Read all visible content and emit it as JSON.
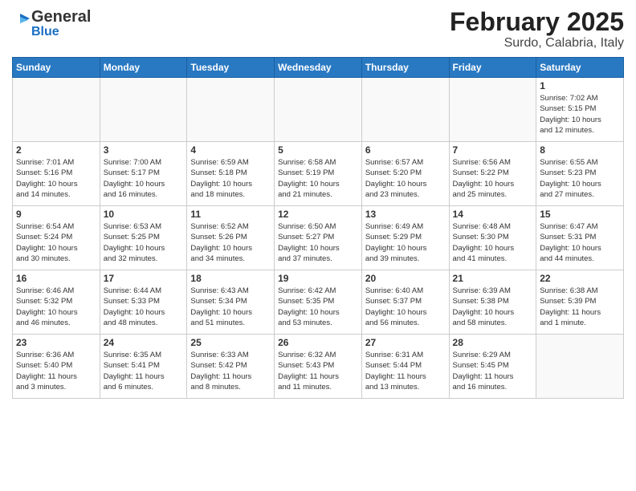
{
  "header": {
    "logo_general": "General",
    "logo_blue": "Blue",
    "title": "February 2025",
    "subtitle": "Surdo, Calabria, Italy"
  },
  "weekdays": [
    "Sunday",
    "Monday",
    "Tuesday",
    "Wednesday",
    "Thursday",
    "Friday",
    "Saturday"
  ],
  "weeks": [
    [
      {
        "day": "",
        "info": ""
      },
      {
        "day": "",
        "info": ""
      },
      {
        "day": "",
        "info": ""
      },
      {
        "day": "",
        "info": ""
      },
      {
        "day": "",
        "info": ""
      },
      {
        "day": "",
        "info": ""
      },
      {
        "day": "1",
        "info": "Sunrise: 7:02 AM\nSunset: 5:15 PM\nDaylight: 10 hours\nand 12 minutes."
      }
    ],
    [
      {
        "day": "2",
        "info": "Sunrise: 7:01 AM\nSunset: 5:16 PM\nDaylight: 10 hours\nand 14 minutes."
      },
      {
        "day": "3",
        "info": "Sunrise: 7:00 AM\nSunset: 5:17 PM\nDaylight: 10 hours\nand 16 minutes."
      },
      {
        "day": "4",
        "info": "Sunrise: 6:59 AM\nSunset: 5:18 PM\nDaylight: 10 hours\nand 18 minutes."
      },
      {
        "day": "5",
        "info": "Sunrise: 6:58 AM\nSunset: 5:19 PM\nDaylight: 10 hours\nand 21 minutes."
      },
      {
        "day": "6",
        "info": "Sunrise: 6:57 AM\nSunset: 5:20 PM\nDaylight: 10 hours\nand 23 minutes."
      },
      {
        "day": "7",
        "info": "Sunrise: 6:56 AM\nSunset: 5:22 PM\nDaylight: 10 hours\nand 25 minutes."
      },
      {
        "day": "8",
        "info": "Sunrise: 6:55 AM\nSunset: 5:23 PM\nDaylight: 10 hours\nand 27 minutes."
      }
    ],
    [
      {
        "day": "9",
        "info": "Sunrise: 6:54 AM\nSunset: 5:24 PM\nDaylight: 10 hours\nand 30 minutes."
      },
      {
        "day": "10",
        "info": "Sunrise: 6:53 AM\nSunset: 5:25 PM\nDaylight: 10 hours\nand 32 minutes."
      },
      {
        "day": "11",
        "info": "Sunrise: 6:52 AM\nSunset: 5:26 PM\nDaylight: 10 hours\nand 34 minutes."
      },
      {
        "day": "12",
        "info": "Sunrise: 6:50 AM\nSunset: 5:27 PM\nDaylight: 10 hours\nand 37 minutes."
      },
      {
        "day": "13",
        "info": "Sunrise: 6:49 AM\nSunset: 5:29 PM\nDaylight: 10 hours\nand 39 minutes."
      },
      {
        "day": "14",
        "info": "Sunrise: 6:48 AM\nSunset: 5:30 PM\nDaylight: 10 hours\nand 41 minutes."
      },
      {
        "day": "15",
        "info": "Sunrise: 6:47 AM\nSunset: 5:31 PM\nDaylight: 10 hours\nand 44 minutes."
      }
    ],
    [
      {
        "day": "16",
        "info": "Sunrise: 6:46 AM\nSunset: 5:32 PM\nDaylight: 10 hours\nand 46 minutes."
      },
      {
        "day": "17",
        "info": "Sunrise: 6:44 AM\nSunset: 5:33 PM\nDaylight: 10 hours\nand 48 minutes."
      },
      {
        "day": "18",
        "info": "Sunrise: 6:43 AM\nSunset: 5:34 PM\nDaylight: 10 hours\nand 51 minutes."
      },
      {
        "day": "19",
        "info": "Sunrise: 6:42 AM\nSunset: 5:35 PM\nDaylight: 10 hours\nand 53 minutes."
      },
      {
        "day": "20",
        "info": "Sunrise: 6:40 AM\nSunset: 5:37 PM\nDaylight: 10 hours\nand 56 minutes."
      },
      {
        "day": "21",
        "info": "Sunrise: 6:39 AM\nSunset: 5:38 PM\nDaylight: 10 hours\nand 58 minutes."
      },
      {
        "day": "22",
        "info": "Sunrise: 6:38 AM\nSunset: 5:39 PM\nDaylight: 11 hours\nand 1 minute."
      }
    ],
    [
      {
        "day": "23",
        "info": "Sunrise: 6:36 AM\nSunset: 5:40 PM\nDaylight: 11 hours\nand 3 minutes."
      },
      {
        "day": "24",
        "info": "Sunrise: 6:35 AM\nSunset: 5:41 PM\nDaylight: 11 hours\nand 6 minutes."
      },
      {
        "day": "25",
        "info": "Sunrise: 6:33 AM\nSunset: 5:42 PM\nDaylight: 11 hours\nand 8 minutes."
      },
      {
        "day": "26",
        "info": "Sunrise: 6:32 AM\nSunset: 5:43 PM\nDaylight: 11 hours\nand 11 minutes."
      },
      {
        "day": "27",
        "info": "Sunrise: 6:31 AM\nSunset: 5:44 PM\nDaylight: 11 hours\nand 13 minutes."
      },
      {
        "day": "28",
        "info": "Sunrise: 6:29 AM\nSunset: 5:45 PM\nDaylight: 11 hours\nand 16 minutes."
      },
      {
        "day": "",
        "info": ""
      }
    ]
  ]
}
